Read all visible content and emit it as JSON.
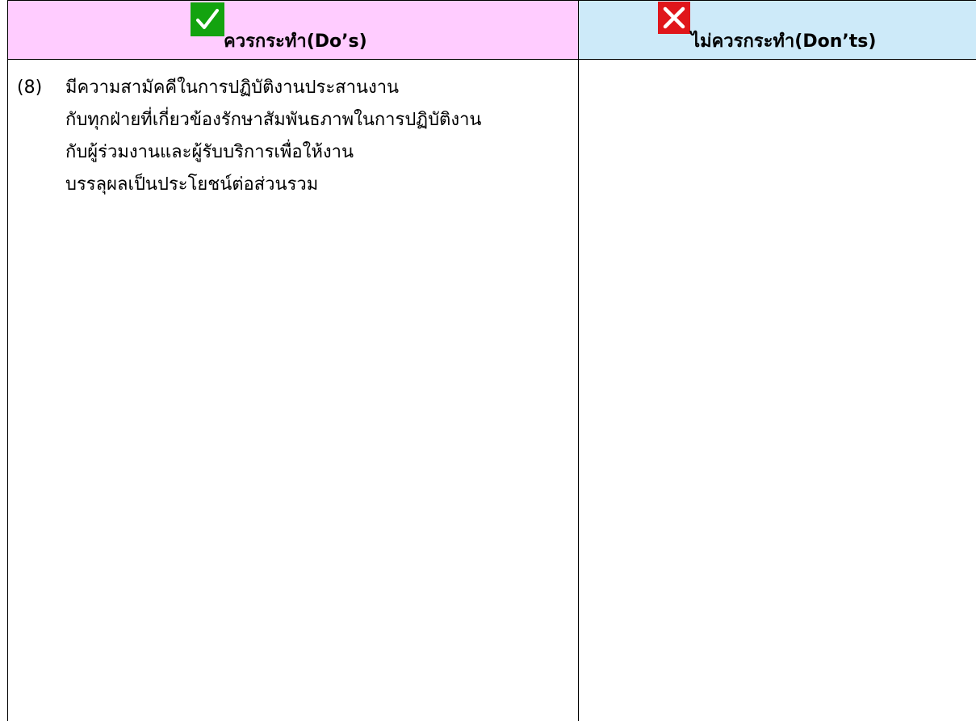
{
  "table": {
    "do_header": {
      "label": "ควรกระทำ(Do’s)",
      "icon": "checkmark-icon",
      "background": "#ffccff",
      "icon_color": "#13a30f"
    },
    "dont_header": {
      "label": "ไม่ควรกระทำ(Don’ts)",
      "icon": "x-mark-icon",
      "background": "#cdeaf9",
      "icon_color": "#e0161b"
    },
    "do_items": [
      {
        "number": "(8)",
        "lines": [
          "มีความสามัคคีในการปฏิบัติงานประสานงาน",
          "กับทุกฝ่ายที่เกี่ยวข้องรักษาสัมพันธภาพในการปฏิบัติงาน",
          "กับผู้ร่วมงานและผู้รับบริการเพื่อให้งาน",
          "บรรลุผลเป็นประโยชน์ต่อส่วนรวม"
        ]
      }
    ],
    "dont_items": []
  }
}
